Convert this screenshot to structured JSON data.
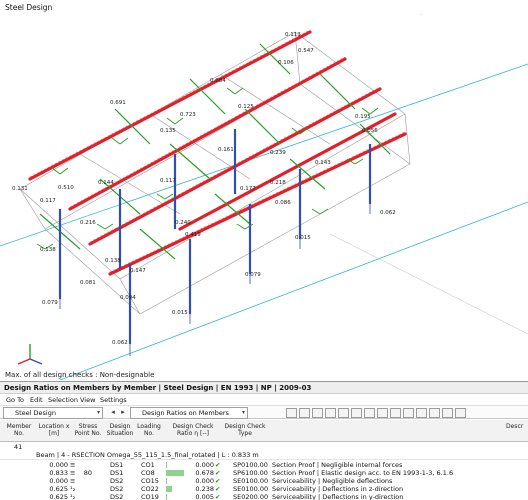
{
  "window": {
    "title": "Steel Design"
  },
  "viewport": {
    "status": "Max. of all design checks : Non-designable",
    "ratios": [
      "0.113",
      "0.142",
      "0.547",
      "0.117",
      "0.102",
      "0.691",
      "0.106",
      "0.684",
      "0.723",
      "0.133",
      "0.125",
      "0.161",
      "0.135",
      "0.056",
      "0.195",
      "0.131",
      "0.510",
      "0.118",
      "0.144",
      "0.117",
      "0.216",
      "0.218",
      "0.177",
      "0.143",
      "0.239",
      "0.138",
      "0.240",
      "0.081",
      "0.138",
      "0.086",
      "0.419",
      "0.419",
      "0.196",
      "0.147",
      "0.139",
      "0.041",
      "0.079",
      "0.062",
      "0.062",
      "0.015",
      "0.015",
      "0.079"
    ],
    "axes": [
      "X",
      "Y",
      "Z"
    ]
  },
  "panel": {
    "title": "Design Ratios on Members by Member | Steel Design | EN 1993 | NP | 2009-03",
    "menu": [
      "Go To",
      "Edit",
      "Selection",
      "View",
      "Settings"
    ],
    "module_select": "Steel Design",
    "table_select": "Design Ratios on Members",
    "columns": [
      "Member No.",
      "Location x [m]",
      "Stress Point No.",
      "Design Situation",
      "Loading No.",
      "Design Check Ratio η [--]",
      "Design Check Type",
      "Descr"
    ],
    "member": "41",
    "group": "Beam | 4 - RSECTION Omega_55_115_1.5_final_rotated | L : 0.833 m",
    "rows": [
      {
        "x": "0.000",
        "mark": "≡",
        "sp": "",
        "ds": "DS1",
        "load": "CO1",
        "ratio": "0.000",
        "ratio_val": 0.0,
        "ok": "✔",
        "type": "SP0100.00",
        "desc": "Section Proof | Negligible internal forces"
      },
      {
        "x": "0.833",
        "mark": "≡",
        "sp": "80",
        "ds": "DS1",
        "load": "CO8",
        "ratio": "0.678",
        "ratio_val": 0.678,
        "ok": "✔",
        "type": "SP6100.00",
        "desc": "Section Proof | Elastic design acc. to EN 1993-1-3, 6.1.6"
      },
      {
        "x": "0.000",
        "mark": "≡",
        "sp": "",
        "ds": "DS2",
        "load": "CO15",
        "ratio": "0.000",
        "ratio_val": 0.0,
        "ok": "✔",
        "type": "SE0100.00",
        "desc": "Serviceability | Negligible deflections"
      },
      {
        "x": "0.625",
        "mark": "¹₂",
        "sp": "",
        "ds": "DS2",
        "load": "CO22",
        "ratio": "0.238",
        "ratio_val": 0.238,
        "ok": "✔",
        "type": "SE0100.00",
        "desc": "Serviceability | Deflections in z-direction"
      },
      {
        "x": "0.625",
        "mark": "¹₂",
        "sp": "",
        "ds": "DS2",
        "load": "CO19",
        "ratio": "0.005",
        "ratio_val": 0.005,
        "ok": "✔",
        "type": "SE0200.00",
        "desc": "Serviceability | Deflections in y-direction"
      },
      {
        "x": "0.417",
        "mark": "¹₂",
        "sp": "",
        "ds": "DS1",
        "load": "CO1",
        "ratio": "Non-designable",
        "ratio_val": 0.0,
        "ok": "⊗",
        "type": "LR5400.00",
        "desc": "Error | Check of lateral-torsional buckling is not available because z-axis is major"
      }
    ]
  },
  "colors": {
    "member_red": "#e0202a",
    "member_green": "#2aa02a",
    "axis_cyan": "#33b8c8",
    "column_blue": "#3050b0",
    "ok_green": "#1a9a1a",
    "error_red": "#e00000"
  },
  "icons": [
    "chevron-down-icon",
    "prev-icon",
    "next-icon",
    "table-icon",
    "filter-icon",
    "error-icon",
    "check-icon"
  ]
}
